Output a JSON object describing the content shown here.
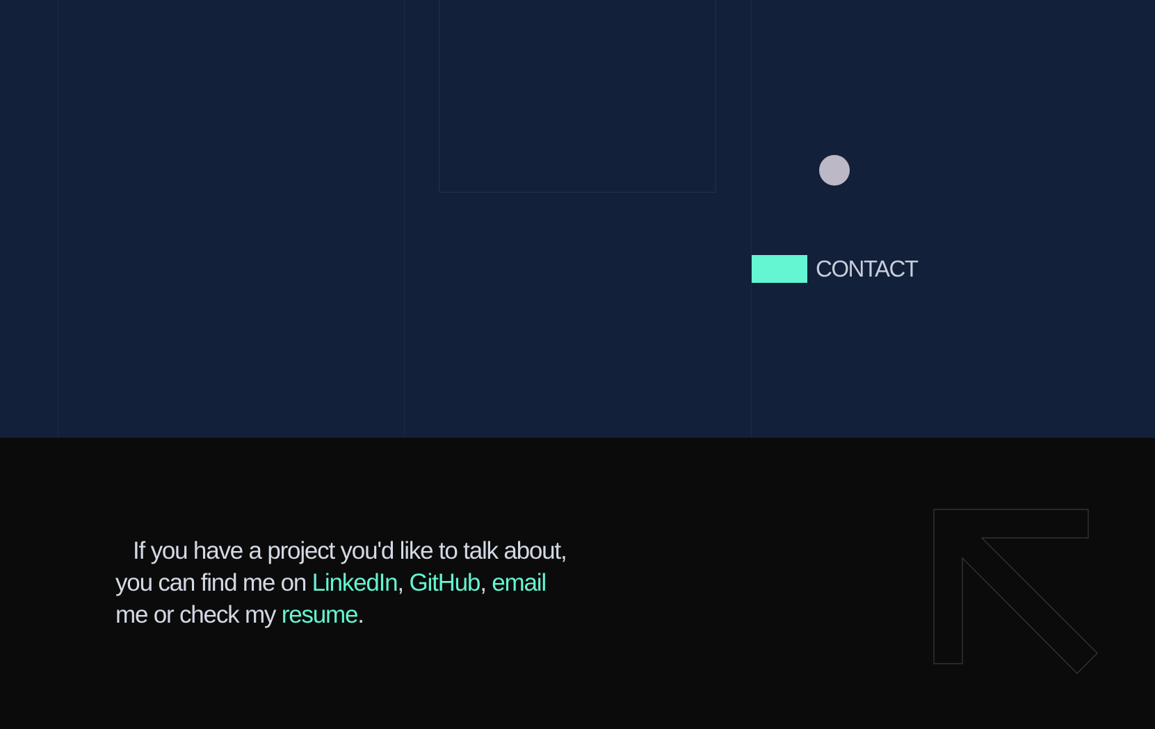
{
  "contact": {
    "label": "CONTACT"
  },
  "message": {
    "line1": "If you have a project you'd like to talk about, you can find me on ",
    "linkedin": "LinkedIn",
    "sep1": ",",
    "github": "GitHub",
    "sep2": ", ",
    "email": "email",
    "mid": " me or check my ",
    "resume": "resume",
    "end": "."
  },
  "colors": {
    "navy_bg": "#12203a",
    "black_bg": "#0b0b0b",
    "accent": "#64f5d2",
    "dot": "#bdb8c6",
    "text": "#d3d9e6"
  },
  "icons": {
    "arrow": "arrow-up-left-outline-icon"
  }
}
